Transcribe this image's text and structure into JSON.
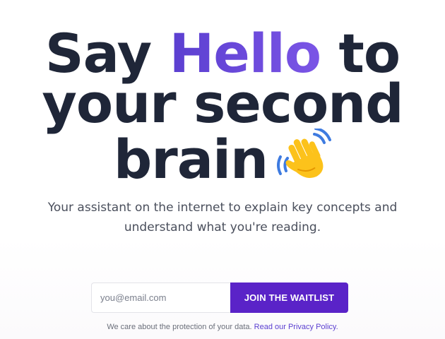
{
  "hero": {
    "headline_part1": "Say ",
    "headline_highlight": "Hello",
    "headline_part2": " to",
    "headline_line2": "your second",
    "headline_line3": "brain",
    "wave_icon": "waving-hand-icon",
    "subtitle": "Your assistant on the internet to explain key concepts and understand what you're reading."
  },
  "signup": {
    "email_placeholder": "you@email.com",
    "button_label": "JOIN THE WAITLIST"
  },
  "privacy": {
    "text": "We care about the protection of your data.",
    "link_text": "Read our Privacy Policy."
  },
  "colors": {
    "headline": "#1f2638",
    "highlight_start": "#5b3fd0",
    "highlight_end": "#7b55e6",
    "button": "#5a23c8",
    "link": "#5b3fd0"
  }
}
